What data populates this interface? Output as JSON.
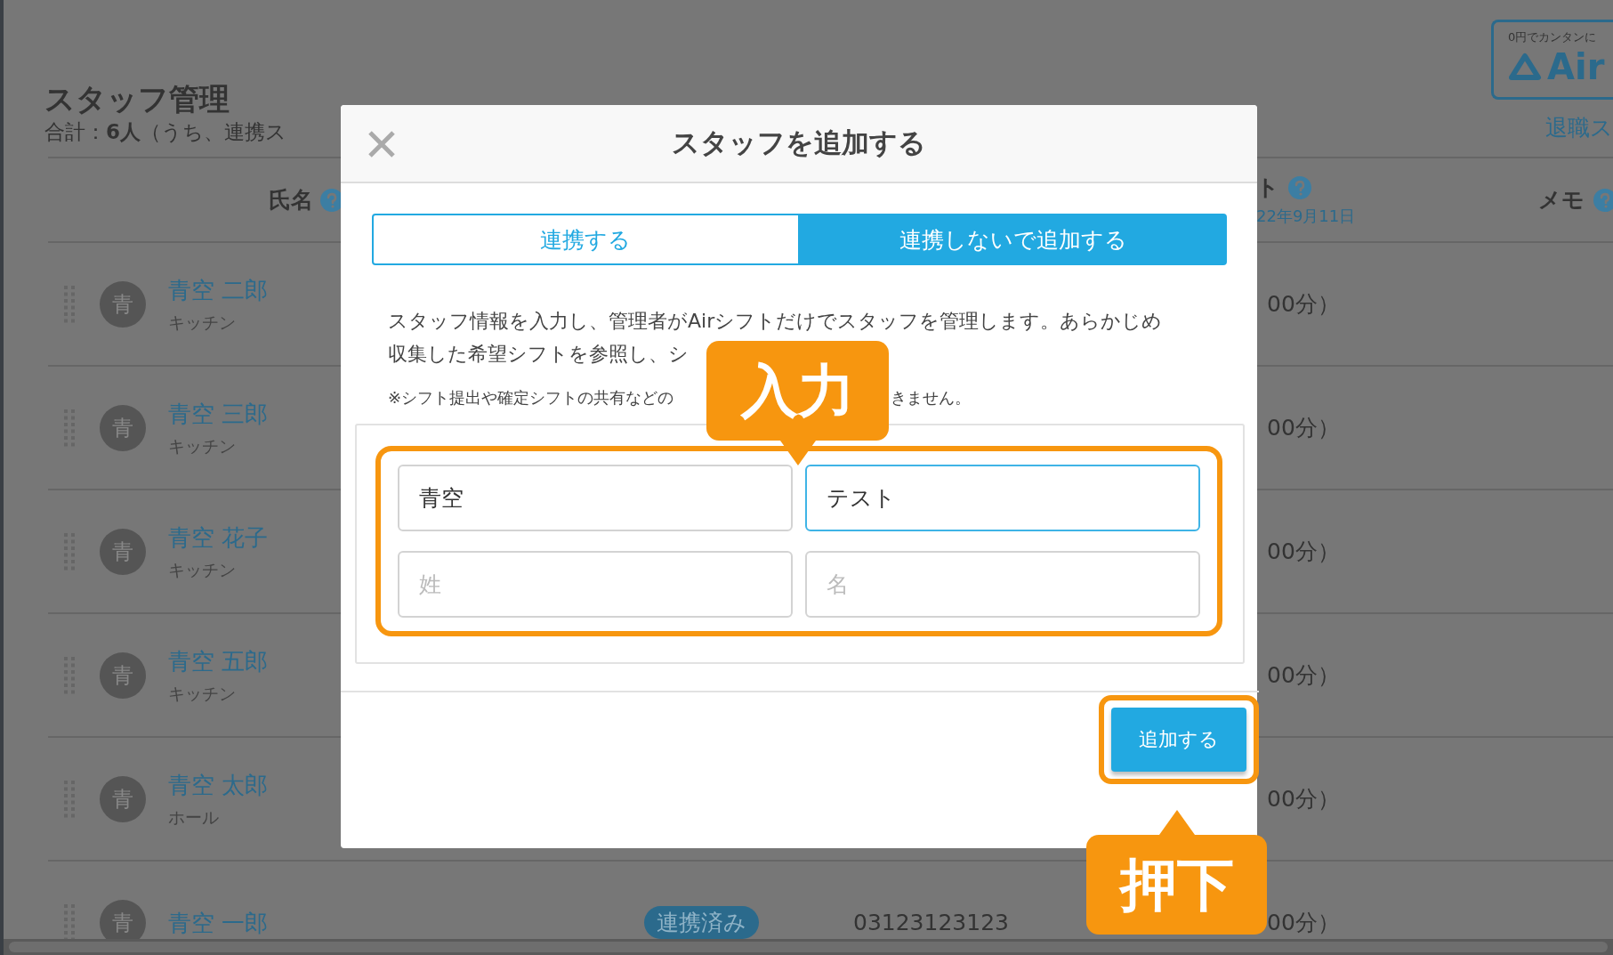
{
  "page": {
    "title": "スタッフ管理",
    "summary": "合計：**6人**（うち、連携ス",
    "promo": {
      "caption": "0円でカンタンに",
      "logo_text": "Air"
    },
    "retired_link": "退職ス"
  },
  "table": {
    "columns": [
      {
        "label": "氏名",
        "help": true
      },
      {
        "label": "ト",
        "sub": "22年9月11日",
        "help": true
      },
      {
        "label": "メモ",
        "help": true
      }
    ],
    "rows": [
      {
        "avatar": "青",
        "name": "青空 二郎",
        "role": "キッチン",
        "shift": "00分）"
      },
      {
        "avatar": "青",
        "name": "青空 三郎",
        "role": "キッチン",
        "shift": "00分）"
      },
      {
        "avatar": "青",
        "name": "青空 花子",
        "role": "キッチン",
        "shift": "00分）"
      },
      {
        "avatar": "青",
        "name": "青空 五郎",
        "role": "キッチン",
        "shift": "00分）"
      },
      {
        "avatar": "青",
        "name": "青空 太郎",
        "role": "ホール",
        "shift": "00分）"
      },
      {
        "avatar": "青",
        "name": "青空 一郎",
        "badge": "連携済み",
        "phone": "03123123123",
        "shift": "00分）"
      }
    ]
  },
  "modal": {
    "title": "スタッフを追加する",
    "tabs": [
      {
        "label": "連携する",
        "selected": false
      },
      {
        "label": "連携しないで追加する",
        "selected": true
      }
    ],
    "description_lines": [
      "スタッフ情報を入力し、管理者がAirシフトだけでスタッフを管理します。あらかじめ",
      "収集した希望シフトを参照し、シ"
    ],
    "note_parts": [
      "※シフト提出や確定シフトの共有などの",
      "きません。"
    ],
    "fields": [
      {
        "value": "青空",
        "focused": false
      },
      {
        "value": "テスト",
        "focused": true
      },
      {
        "placeholder": "姓",
        "focused": false
      },
      {
        "placeholder": "名",
        "focused": false
      }
    ],
    "submit": "追加する"
  },
  "annotations": [
    {
      "label": "入力"
    },
    {
      "label": "押下"
    }
  ]
}
